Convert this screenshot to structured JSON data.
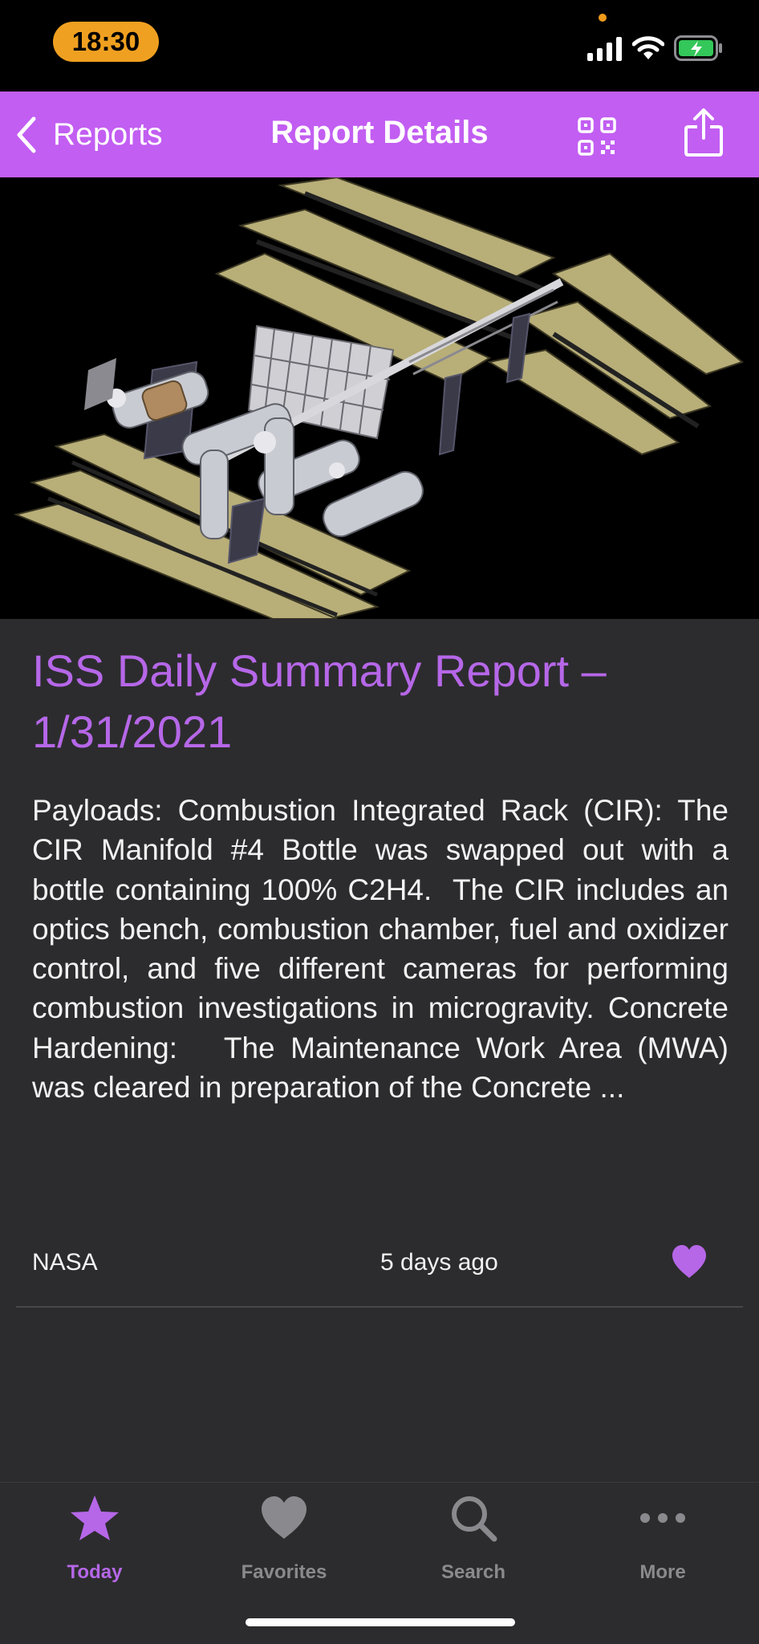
{
  "status_bar": {
    "time": "18:30",
    "icons": [
      "signal-icon",
      "wifi-icon",
      "battery-charging-icon"
    ]
  },
  "nav": {
    "back_label": "Reports",
    "title": "Report Details",
    "icons": [
      "chevron-left-icon",
      "qr-code-icon",
      "share-icon"
    ]
  },
  "hero": {
    "icon": "space-station-image"
  },
  "article": {
    "title": "ISS Daily Summary Report – 1/31/2021",
    "body": "Payloads: Combustion Integrated Rack (CIR): The CIR Manifold #4 Bottle was swapped out with a bottle containing 100% C2H4.  The CIR includes an optics bench, combustion chamber, fuel and oxidizer control, and five different cameras for performing combustion investigations in microgravity. Concrete Hardening:   The Maintenance Work Area (MWA) was cleared in preparation of the Concrete ...",
    "source": "NASA",
    "date": "5 days ago",
    "favorite_icon": "heart-filled-icon"
  },
  "tabs": [
    {
      "label": "Today",
      "icon": "star-icon",
      "active": true
    },
    {
      "label": "Favorites",
      "icon": "heart-icon",
      "active": false
    },
    {
      "label": "Search",
      "icon": "search-icon",
      "active": false
    },
    {
      "label": "More",
      "icon": "ellipsis-icon",
      "active": false
    }
  ],
  "colors": {
    "accent": "#c25ef2",
    "accent_text": "#b667e8",
    "background": "#2c2c2e",
    "inactive_tab": "#8a8a8e",
    "time_pill": "#f0a020"
  }
}
